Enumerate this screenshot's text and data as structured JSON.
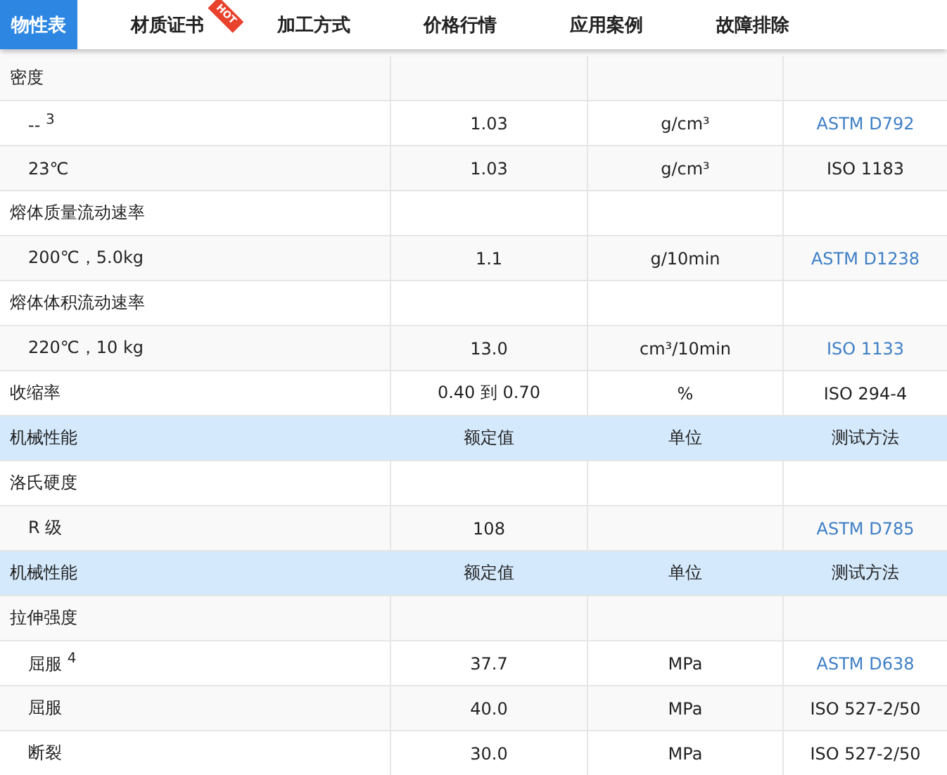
{
  "tabs": [
    {
      "label": "物性表",
      "selected": true
    },
    {
      "label": "材质证书",
      "selected": false,
      "badge": "HOT"
    },
    {
      "label": "加工方式",
      "selected": false
    },
    {
      "label": "价格行情",
      "selected": false
    },
    {
      "label": "应用案例",
      "selected": false
    },
    {
      "label": "故障排除",
      "selected": false
    }
  ],
  "rows": [
    {
      "kind": "group",
      "name": "密度"
    },
    {
      "kind": "item",
      "name": "-- $^{3}$",
      "value": "1.03",
      "unit": "g/cm³",
      "method": "ASTM D792",
      "link": true
    },
    {
      "kind": "item",
      "name": "23℃",
      "value": "1.03",
      "unit": "g/cm³",
      "method": "ISO 1183",
      "link": false
    },
    {
      "kind": "group",
      "name": "熔体质量流动速率"
    },
    {
      "kind": "item",
      "name": "200℃，5.0kg",
      "value": "1.1",
      "unit": "g/10min",
      "method": "ASTM D1238",
      "link": true
    },
    {
      "kind": "group",
      "name": "熔体体积流动速率"
    },
    {
      "kind": "item",
      "name": "220℃，10 kg",
      "value": "13.0",
      "unit": "cm³/10min",
      "method": "ISO 1133",
      "link": true
    },
    {
      "kind": "plain",
      "name": "收缩率",
      "value": "0.40 到 0.70",
      "unit": "%",
      "method": "ISO 294-4",
      "link": false
    },
    {
      "kind": "header",
      "name": "机械性能",
      "value": "额定值",
      "unit": "单位",
      "method": "测试方法"
    },
    {
      "kind": "group",
      "name": "洛氏硬度"
    },
    {
      "kind": "item",
      "name": "R 级",
      "value": "108",
      "method": "ASTM D785",
      "link": true
    },
    {
      "kind": "header",
      "name": "机械性能",
      "value": "额定值",
      "unit": "单位",
      "method": "测试方法"
    },
    {
      "kind": "group",
      "name": "拉伸强度"
    },
    {
      "kind": "item",
      "name": "屈服 $^{4}$",
      "value": "37.7",
      "unit": "MPa",
      "method": "ASTM D638",
      "link": true
    },
    {
      "kind": "item",
      "name": "屈服",
      "value": "40.0",
      "unit": "MPa",
      "method": "ISO 527-2/50",
      "link": false
    },
    {
      "kind": "item",
      "name": "断裂",
      "value": "30.0",
      "unit": "MPa",
      "method": "ISO 527-2/50",
      "link": false
    }
  ]
}
